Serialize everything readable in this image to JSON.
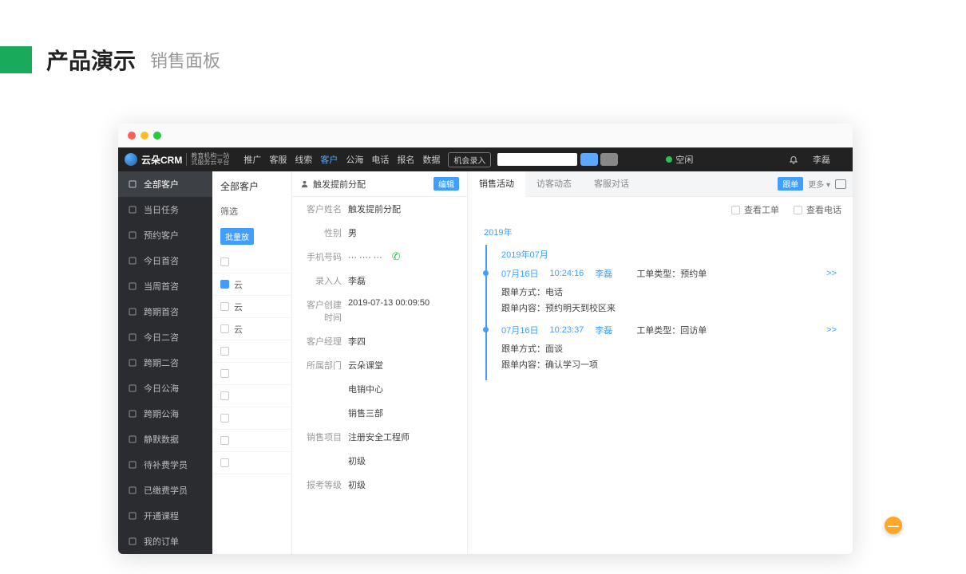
{
  "page": {
    "title_main": "产品演示",
    "title_sub": "销售面板"
  },
  "logo": {
    "name": "云朵CRM",
    "tag1": "教育机构一站",
    "tag2": "式服务云平台"
  },
  "menu": [
    "推广",
    "客服",
    "线索",
    "客户",
    "公海",
    "电话",
    "报名",
    "数据"
  ],
  "menu_active_index": 3,
  "menu_button": "机会录入",
  "status": "空闲",
  "user": "李磊",
  "sidebar": [
    "全部客户",
    "当日任务",
    "预约客户",
    "今日首咨",
    "当周首咨",
    "跨期首咨",
    "今日二咨",
    "跨期二咨",
    "今日公海",
    "跨期公海",
    "静默数据",
    "待补费学员",
    "已缴费学员",
    "开通课程",
    "我的订单"
  ],
  "sidebar_active_index": 0,
  "list": {
    "head": "全部客户",
    "filter": "筛选",
    "batch": "批量放",
    "rows": [
      "",
      "云",
      "云",
      "云",
      "",
      "",
      "",
      "",
      "",
      ""
    ]
  },
  "detail": {
    "title": "触发提前分配",
    "edit": "编辑",
    "fields": [
      {
        "label": "客户姓名",
        "value": "触发提前分配"
      },
      {
        "label": "性别",
        "value": "男"
      },
      {
        "label": "手机号码",
        "value": "··· ···· ···",
        "phone": true
      },
      {
        "label": "录入人",
        "value": "李磊"
      },
      {
        "label": "客户创建时间",
        "value": "2019-07-13 00:09:50"
      },
      {
        "label": "客户经理",
        "value": "李四"
      },
      {
        "label": "所属部门",
        "value": "云朵课堂"
      },
      {
        "label": "",
        "value": "电销中心"
      },
      {
        "label": "",
        "value": "销售三部"
      },
      {
        "label": "销售项目",
        "value": "注册安全工程师"
      },
      {
        "label": "",
        "value": "初级"
      },
      {
        "label": "报考等级",
        "value": "初级"
      }
    ]
  },
  "activity": {
    "tabs": [
      "销售活动",
      "访客动态",
      "客服对话"
    ],
    "track_btn": "跟单",
    "more": "更多",
    "checks": [
      "查看工单",
      "查看电话"
    ],
    "year": "2019年",
    "month": "2019年07月",
    "entries": [
      {
        "date": "07月16日",
        "time": "10:24:16",
        "user": "李磊",
        "type_label": "工单类型：",
        "type": "预约单",
        "method_label": "跟单方式：",
        "method": "电话",
        "content_label": "跟单内容：",
        "content": "预约明天到校区来",
        "expand": ">>"
      },
      {
        "date": "07月16日",
        "time": "10:23:37",
        "user": "李磊",
        "type_label": "工单类型：",
        "type": "回访单",
        "method_label": "跟单方式：",
        "method": "面谈",
        "content_label": "跟单内容：",
        "content": "确认学习一项",
        "expand": ">>"
      }
    ]
  }
}
